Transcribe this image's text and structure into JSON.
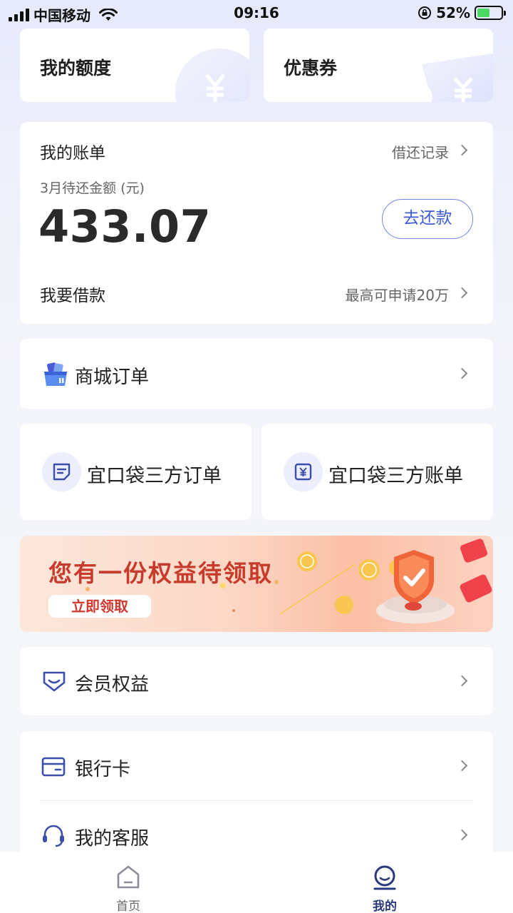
{
  "status_bar": {
    "carrier": "中国移动",
    "time": "09:16",
    "battery": "52%"
  },
  "cards": {
    "quota": "我的额度",
    "coupon": "优惠券"
  },
  "bill": {
    "title": "我的账单",
    "history_link": "借还记录",
    "month_label": "3月待还金额 (元)",
    "amount": "433.07",
    "repay_button": "去还款",
    "borrow_label": "我要借款",
    "borrow_note": "最高可申请20万"
  },
  "mall_order": {
    "label": "商城订单"
  },
  "third_party": {
    "orders": "宜口袋三方订单",
    "bills": "宜口袋三方账单"
  },
  "banner": {
    "headline": "您有一份权益待领取",
    "cta": "立即领取"
  },
  "member": {
    "label": "会员权益"
  },
  "bank_card": {
    "label": "银行卡"
  },
  "service": {
    "label": "我的客服"
  },
  "tabbar": {
    "home": "首页",
    "mine": "我的",
    "active_color": "#2b3a7a",
    "inactive_color": "#666666"
  },
  "colors": {
    "accent": "#3f5cd6",
    "icon": "#3b4fa8",
    "banner_text": "#c83b2c"
  }
}
